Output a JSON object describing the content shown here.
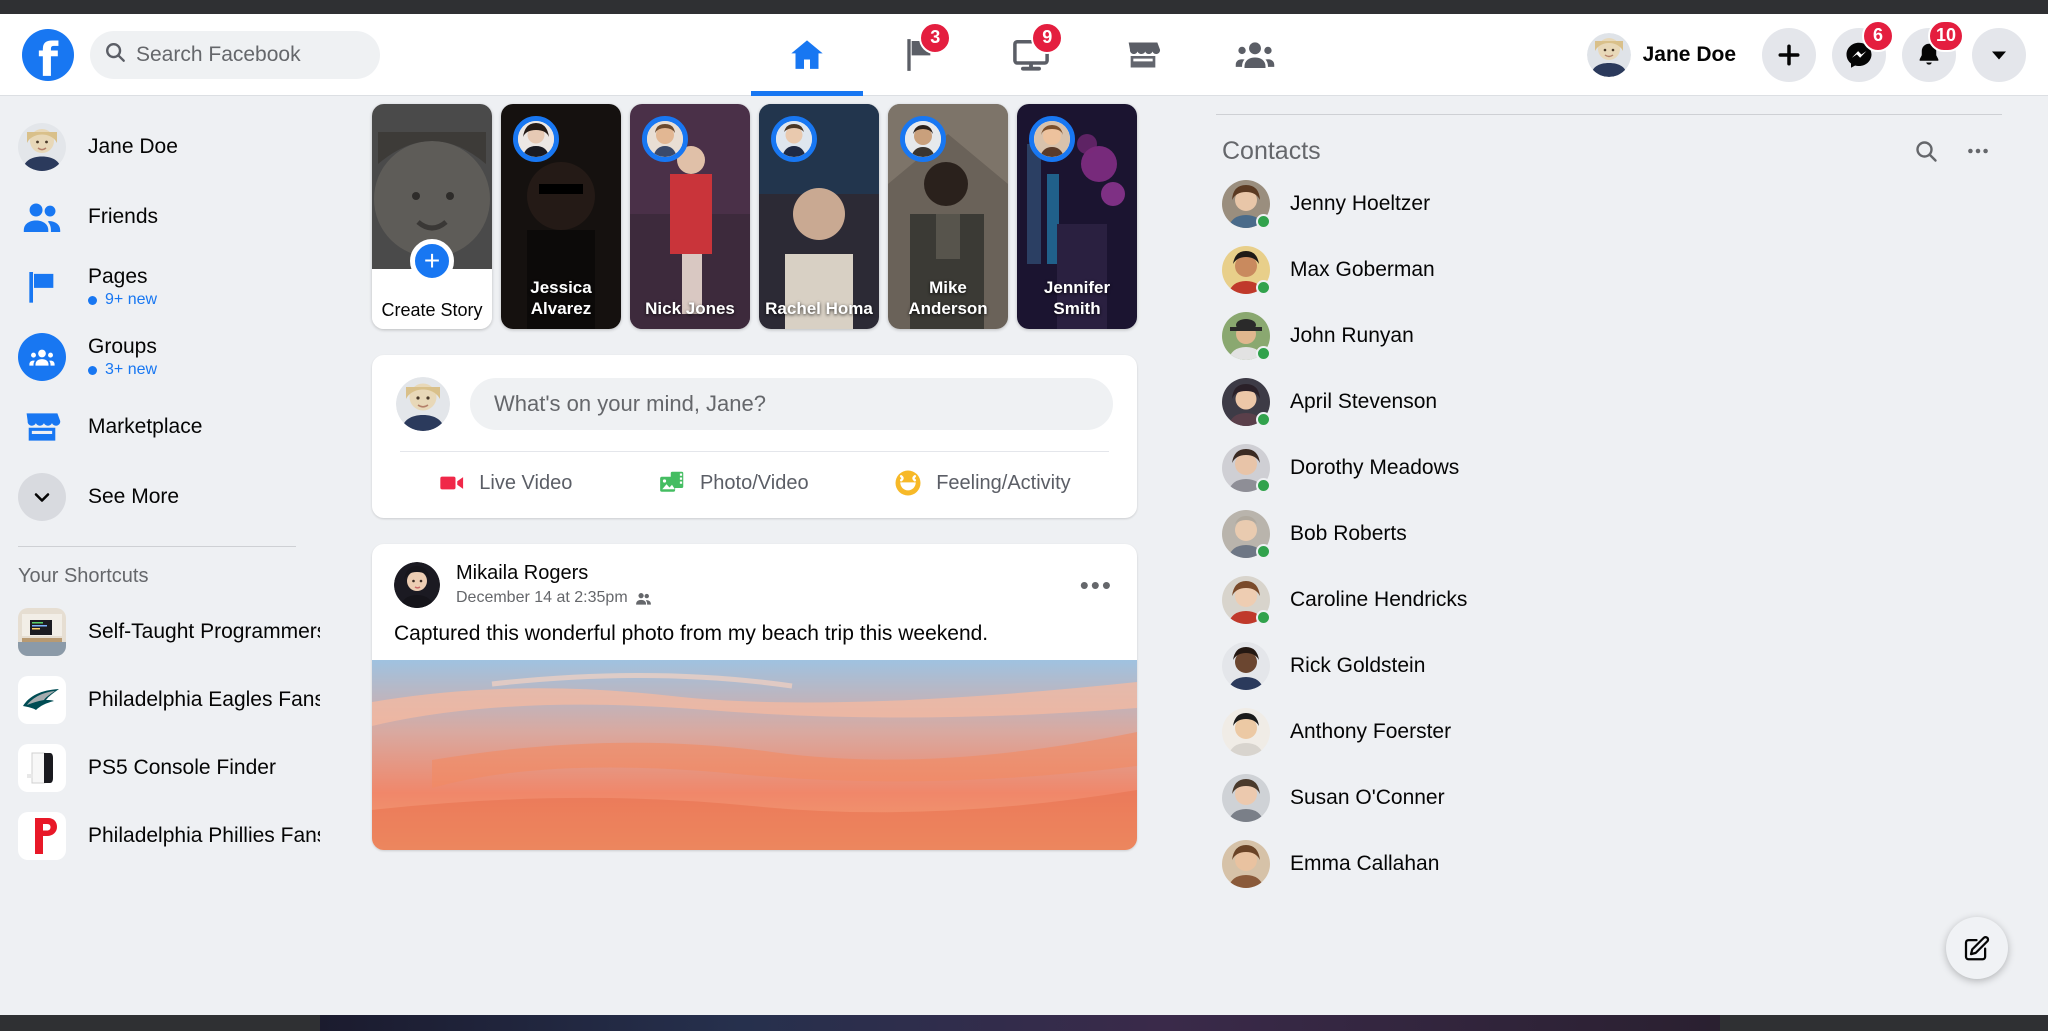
{
  "header": {
    "logo": "facebook-f-logo",
    "search": {
      "placeholder": "Search Facebook",
      "icon": "search-icon"
    },
    "nav": [
      {
        "name": "home",
        "icon": "home-icon",
        "badge": "",
        "active": true
      },
      {
        "name": "pages",
        "icon": "flag-icon",
        "badge": "3",
        "active": false
      },
      {
        "name": "watch",
        "icon": "monitor-icon",
        "badge": "9",
        "active": false
      },
      {
        "name": "marketplace",
        "icon": "store-icon",
        "badge": "",
        "active": false
      },
      {
        "name": "groups",
        "icon": "people-icon",
        "badge": "",
        "active": false
      }
    ],
    "profile_name": "Jane Doe",
    "actions": [
      {
        "name": "create",
        "icon": "plus-icon",
        "badge": ""
      },
      {
        "name": "messenger",
        "icon": "messenger-icon",
        "badge": "6"
      },
      {
        "name": "notifications",
        "icon": "bell-icon",
        "badge": "10"
      },
      {
        "name": "account",
        "icon": "chevron-down-icon",
        "badge": ""
      }
    ]
  },
  "sidebar": {
    "items": [
      {
        "label": "Jane Doe",
        "sub": "",
        "icon": "avatar"
      },
      {
        "label": "Friends",
        "sub": "",
        "icon": "friends-icon"
      },
      {
        "label": "Pages",
        "sub": "9+ new",
        "icon": "flag-icon"
      },
      {
        "label": "Groups",
        "sub": "3+ new",
        "icon": "groups-icon"
      },
      {
        "label": "Marketplace",
        "sub": "",
        "icon": "store-icon"
      },
      {
        "label": "See More",
        "sub": "",
        "icon": "chevron-down-icon"
      }
    ],
    "shortcuts_title": "Your Shortcuts",
    "shortcuts": [
      {
        "label": "Self-Taught Programmers",
        "icon": "desk-photo"
      },
      {
        "label": "Philadelphia Eagles Fans",
        "icon": "eagles-logo"
      },
      {
        "label": "PS5 Console Finder",
        "icon": "ps5-photo"
      },
      {
        "label": "Philadelphia Phillies Fans",
        "icon": "phillies-logo"
      }
    ]
  },
  "stories": [
    {
      "name": "Create Story",
      "type": "create"
    },
    {
      "name": "Jessica Alvarez",
      "type": "story"
    },
    {
      "name": "Nick Jones",
      "type": "story"
    },
    {
      "name": "Rachel Homa",
      "type": "story"
    },
    {
      "name": "Mike Anderson",
      "type": "story"
    },
    {
      "name": "Jennifer Smith",
      "type": "story"
    }
  ],
  "composer": {
    "placeholder": "What's on your mind, Jane?",
    "actions": [
      {
        "label": "Live Video",
        "icon": "video-camera-icon",
        "color": "#f02849"
      },
      {
        "label": "Photo/Video",
        "icon": "photo-video-icon",
        "color": "#45bd62"
      },
      {
        "label": "Feeling/Activity",
        "icon": "smiley-icon",
        "color": "#f7b928"
      }
    ]
  },
  "post": {
    "author": "Mikaila Rogers",
    "timestamp": "December 14 at 2:35pm",
    "audience_icon": "friends-icon",
    "menu_icon": "ellipsis-icon",
    "text": "Captured this wonderful photo from my beach trip this weekend."
  },
  "contacts": {
    "title": "Contacts",
    "search_icon": "search-icon",
    "more_icon": "ellipsis-icon",
    "list": [
      {
        "name": "Jenny Hoeltzer",
        "online": true
      },
      {
        "name": "Max Goberman",
        "online": true
      },
      {
        "name": "John Runyan",
        "online": true
      },
      {
        "name": "April Stevenson",
        "online": true
      },
      {
        "name": "Dorothy Meadows",
        "online": true
      },
      {
        "name": "Bob Roberts",
        "online": true
      },
      {
        "name": "Caroline Hendricks",
        "online": true
      },
      {
        "name": "Rick Goldstein",
        "online": false
      },
      {
        "name": "Anthony Foerster",
        "online": false
      },
      {
        "name": "Susan O'Conner",
        "online": false
      },
      {
        "name": "Emma Callahan",
        "online": false
      }
    ],
    "compose_fab_icon": "compose-icon"
  },
  "colors": {
    "brand": "#1877f2",
    "badge": "#e41e3f",
    "online": "#31a24c",
    "page_bg": "#f0f2f5",
    "card_bg": "#ffffff"
  }
}
